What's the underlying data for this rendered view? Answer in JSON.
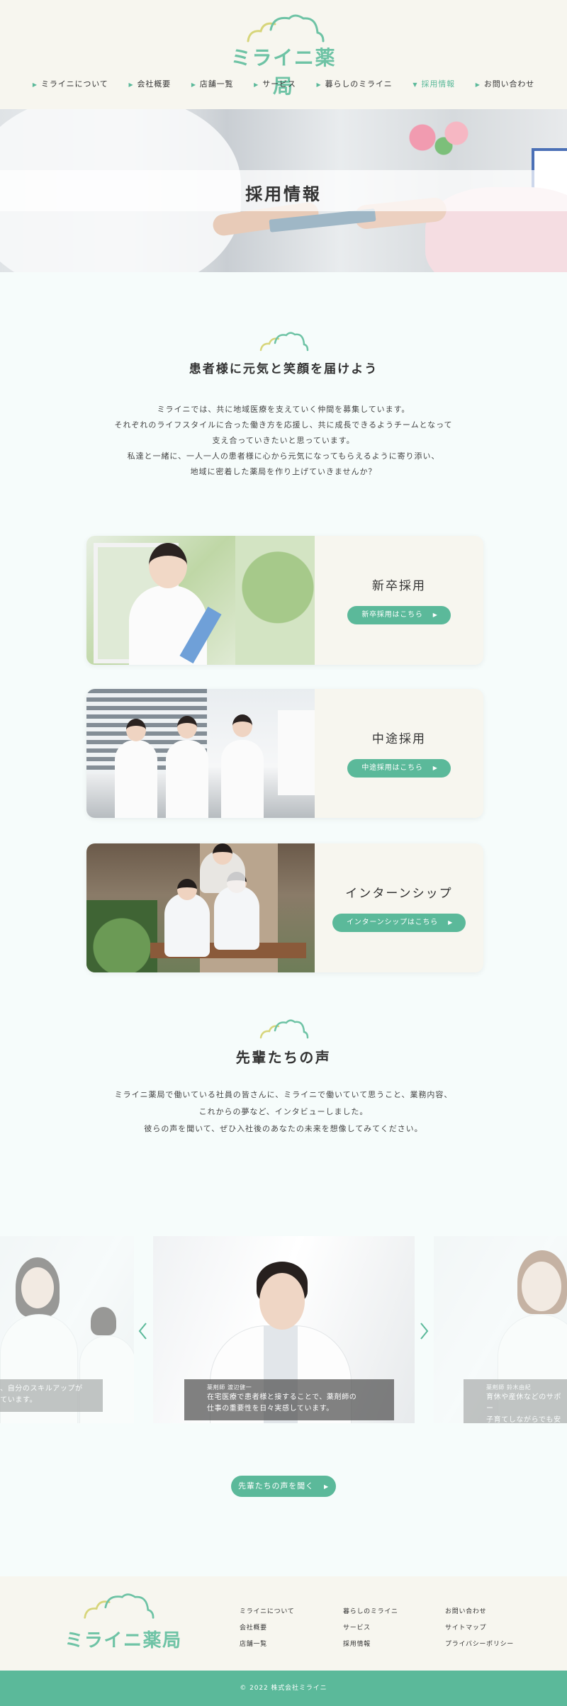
{
  "header": {
    "logo_text": "ミライニ薬局",
    "nav": [
      {
        "label": "ミライニについて",
        "active": false
      },
      {
        "label": "会社概要",
        "active": false
      },
      {
        "label": "店舗一覧",
        "active": false
      },
      {
        "label": "サービス",
        "active": false
      },
      {
        "label": "暮らしのミライニ",
        "active": false
      },
      {
        "label": "採用情報",
        "active": true
      },
      {
        "label": "お問い合わせ",
        "active": false
      }
    ]
  },
  "hero": {
    "title": "採用情報"
  },
  "intro": {
    "heading": "患者様に元気と笑顔を届けよう",
    "lines": [
      "ミライニでは、共に地域医療を支えていく仲間を募集しています。",
      "それぞれのライフスタイルに合った働き方を応援し、共に成長できるようチームとなって",
      "支え合っていきたいと思っています。",
      "私達と一緒に、一人一人の患者様に心から元気になってもらえるように寄り添い、",
      "地域に密着した薬局を作り上げていきませんか？"
    ]
  },
  "recruit": [
    {
      "title": "新卒採用",
      "button": "新卒採用はこちら"
    },
    {
      "title": "中途採用",
      "button": "中途採用はこちら"
    },
    {
      "title": "インターンシップ",
      "button": "インターンシップはこちら"
    }
  ],
  "voices": {
    "heading": "先輩たちの声",
    "lines": [
      "ミライニ薬局で働いている社員の皆さんに、ミライニで働いていて思うこと、業務内容、",
      "これからの夢など、インタビューしました。",
      "彼らの声を聞いて、ぜひ入社後のあなたの未来を想像してみてください。"
    ],
    "slides": [
      {
        "role": "",
        "text_line1": "ど、自分のスキルアップが",
        "text_line2": "しています。"
      },
      {
        "role": "薬剤師 渡辺健一",
        "text_line1": "在宅医療で患者様と接することで、薬剤師の",
        "text_line2": "仕事の重要性を日々実感しています。"
      },
      {
        "role": "薬剤師 鈴木由紀",
        "text_line1": "育休や産休などのサポー",
        "text_line2": "子育てしながらでも安"
      }
    ],
    "button": "先輩たちの声を聞く"
  },
  "footer": {
    "logo_text": "ミライニ薬局",
    "col1": [
      "ミライニについて",
      "会社概要",
      "店舗一覧"
    ],
    "col2": [
      "暮らしのミライニ",
      "サービス",
      "採用情報"
    ],
    "col3": [
      "お問い合わせ",
      "サイトマップ",
      "プライバシーポリシー"
    ],
    "copyright": "© 2022 株式会社ミライニ"
  },
  "colors": {
    "accent": "#5bb99a",
    "logo": "#6ec3a5",
    "cream": "#f7f6ef",
    "cloud_yellow": "#d7d57a"
  }
}
